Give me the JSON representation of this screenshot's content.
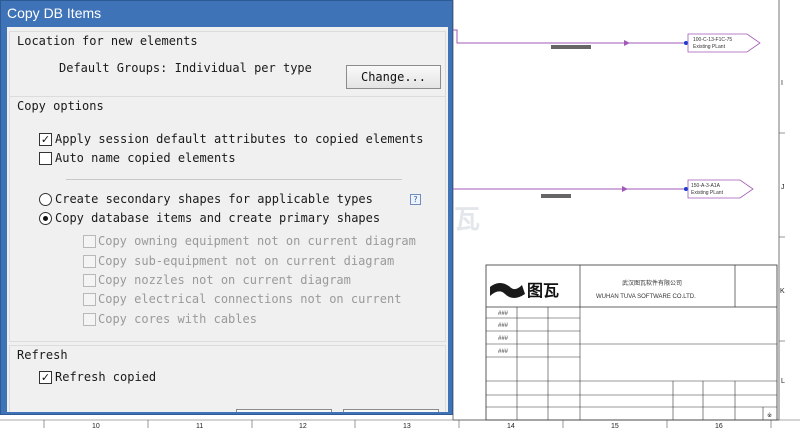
{
  "dialog": {
    "title": "Copy DB Items",
    "location_group": {
      "title": "Location for new elements",
      "value": "Default Groups: Individual per type",
      "change_button": "Change..."
    },
    "copy_options": {
      "title": "Copy options",
      "apply_session_defaults": {
        "label": "Apply session default attributes to copied elements",
        "checked": true
      },
      "auto_name": {
        "label": "Auto name copied elements",
        "checked": false
      },
      "radio_secondary": {
        "label": "Create secondary shapes for applicable types",
        "selected": false
      },
      "radio_primary": {
        "label": "Copy database items and create primary shapes",
        "selected": true
      },
      "help_glyph": "?",
      "sub_options": [
        {
          "label": "Copy owning equipment not on current diagram",
          "checked": false
        },
        {
          "label": "Copy sub-equipment not on current diagram",
          "checked": false
        },
        {
          "label": "Copy nozzles not on current diagram",
          "checked": false
        },
        {
          "label": "Copy electrical connections not on current",
          "checked": false
        },
        {
          "label": "Copy cores with cables",
          "checked": false
        }
      ]
    },
    "refresh": {
      "title": "Refresh",
      "refresh_copied": {
        "label": "Refresh copied",
        "checked": true
      }
    }
  },
  "diagram": {
    "tag1": {
      "line1": "100-C-13-F1C-75",
      "line2": "Existing PLant"
    },
    "tag2": {
      "line1": "150-A-3-A1A",
      "line2": "Existing PLant"
    },
    "row_labels": [
      "I",
      "J",
      "K",
      "L"
    ],
    "ruler": [
      "10",
      "11",
      "12",
      "13",
      "14",
      "15",
      "16"
    ],
    "watermark_text": "图瓦",
    "title_block": {
      "logo_text": "图瓦",
      "company_cn": "武汉图瓦软件有限公司",
      "company_en": "WUHAN TUVA SOFTWARE CO.LTD.",
      "rows": [
        "###",
        "###",
        "###",
        "###"
      ],
      "corner": "※"
    },
    "colors": {
      "line": "#a25ab8",
      "dialog_frame": "#3f73b8"
    }
  }
}
